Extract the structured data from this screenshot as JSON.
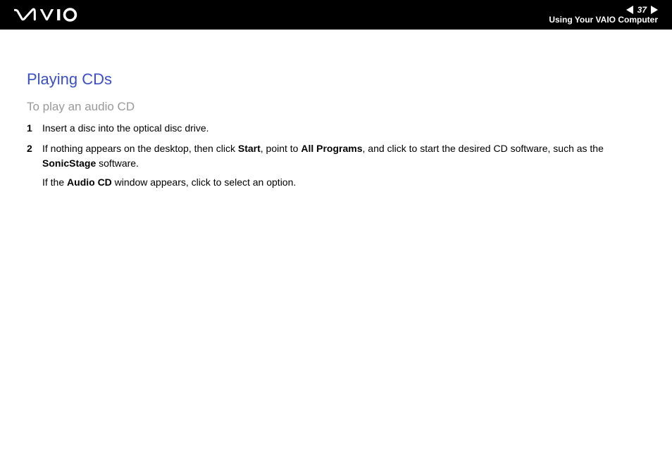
{
  "header": {
    "page_number": "37",
    "section": "Using Your VAIO Computer"
  },
  "content": {
    "title": "Playing CDs",
    "subtitle": "To play an audio CD",
    "steps": [
      {
        "num": "1",
        "text": "Insert a disc into the optical disc drive."
      },
      {
        "num": "2",
        "text_pre": "If nothing appears on the desktop, then click ",
        "bold1": "Start",
        "mid1": ", point to ",
        "bold2": "All Programs",
        "mid2": ", and click to start the desired CD software, such as the ",
        "bold3": "SonicStage",
        "text_post": " software.",
        "note_pre": "If the ",
        "note_bold": "Audio CD",
        "note_post": " window appears, click to select an option."
      }
    ]
  }
}
